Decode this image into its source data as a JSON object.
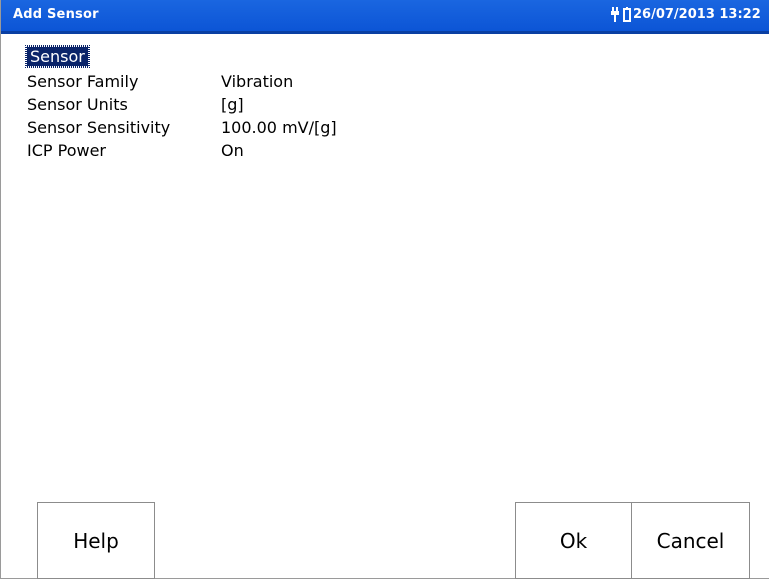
{
  "window": {
    "title": "Add Sensor",
    "datetime": "26/07/2013 13:22",
    "title_bar_color": "#0c55d6",
    "status_icons": [
      "plug-icon",
      "battery-icon"
    ]
  },
  "section": {
    "header": "Sensor"
  },
  "fields": [
    {
      "label": "Sensor Family",
      "value": "Vibration"
    },
    {
      "label": "Sensor Units",
      "value": "[g]"
    },
    {
      "label": "Sensor Sensitivity",
      "value": "100.00 mV/[g]"
    },
    {
      "label": "ICP Power",
      "value": "On"
    }
  ],
  "buttons": {
    "help": "Help",
    "ok": "Ok",
    "cancel": "Cancel"
  }
}
